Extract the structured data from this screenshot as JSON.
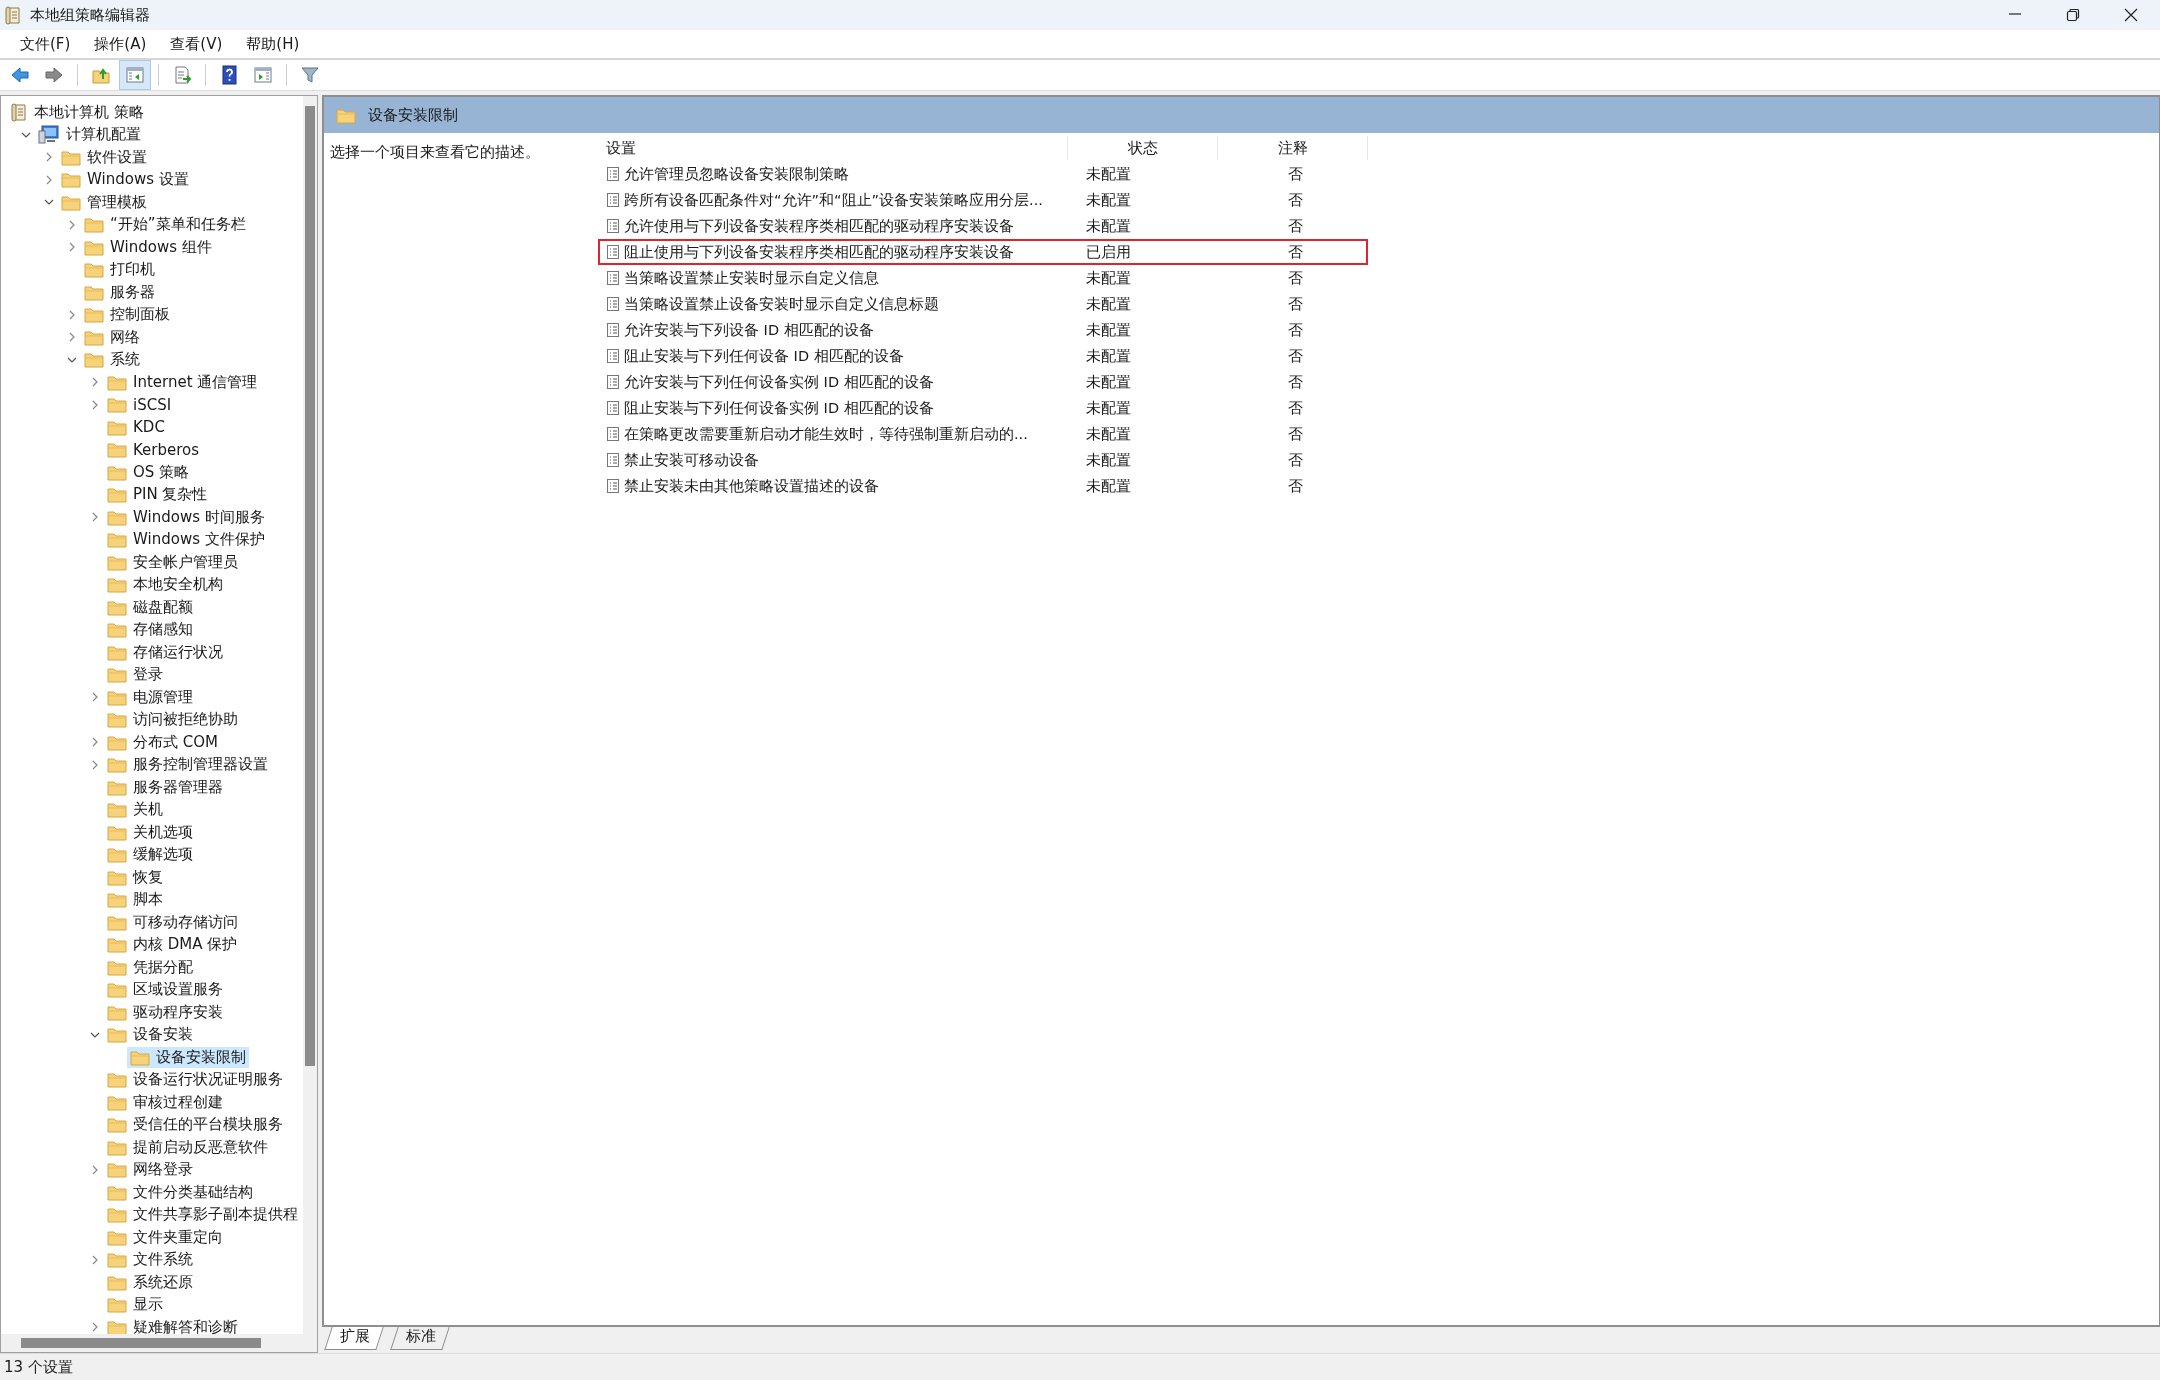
{
  "window": {
    "title": "本地组策略编辑器"
  },
  "menu": [
    "文件(F)",
    "操作(A)",
    "查看(V)",
    "帮助(H)"
  ],
  "toolbar": [
    {
      "pressed": false
    },
    {
      "pressed": false
    },
    {
      "pressed": false
    },
    {
      "pressed": true
    },
    {
      "pressed": false
    },
    {
      "pressed": false
    },
    {
      "pressed": false
    },
    {
      "pressed": false
    }
  ],
  "tree": [
    {
      "label": "本地计算机 策略",
      "kind": "policy",
      "selected": false,
      "children": [
        {
          "label": "计算机配置",
          "kind": "computer",
          "selected": false,
          "expanded": true,
          "children": [
            {
              "label": "软件设置",
              "kind": "folder",
              "selected": false,
              "expanded": false
            },
            {
              "label": "Windows 设置",
              "kind": "folder",
              "selected": false,
              "expanded": false
            },
            {
              "label": "管理模板",
              "kind": "folder",
              "selected": false,
              "expanded": true,
              "children": [
                {
                  "label": "“开始”菜单和任务栏",
                  "kind": "folder",
                  "selected": false,
                  "expanded": false
                },
                {
                  "label": "Windows 组件",
                  "kind": "folder",
                  "selected": false,
                  "expanded": false
                },
                {
                  "label": "打印机",
                  "kind": "folder",
                  "selected": false
                },
                {
                  "label": "服务器",
                  "kind": "folder",
                  "selected": false
                },
                {
                  "label": "控制面板",
                  "kind": "folder",
                  "selected": false,
                  "expanded": false
                },
                {
                  "label": "网络",
                  "kind": "folder",
                  "selected": false,
                  "expanded": false
                },
                {
                  "label": "系统",
                  "kind": "folder",
                  "selected": false,
                  "expanded": true,
                  "children": [
                    {
                      "label": "Internet 通信管理",
                      "kind": "folder",
                      "selected": false,
                      "expanded": false
                    },
                    {
                      "label": "iSCSI",
                      "kind": "folder",
                      "selected": false,
                      "expanded": false
                    },
                    {
                      "label": "KDC",
                      "kind": "folder",
                      "selected": false
                    },
                    {
                      "label": "Kerberos",
                      "kind": "folder",
                      "selected": false
                    },
                    {
                      "label": "OS 策略",
                      "kind": "folder",
                      "selected": false
                    },
                    {
                      "label": "PIN 复杂性",
                      "kind": "folder",
                      "selected": false
                    },
                    {
                      "label": "Windows 时间服务",
                      "kind": "folder",
                      "selected": false,
                      "expanded": false
                    },
                    {
                      "label": "Windows 文件保护",
                      "kind": "folder",
                      "selected": false
                    },
                    {
                      "label": "安全帐户管理员",
                      "kind": "folder",
                      "selected": false
                    },
                    {
                      "label": "本地安全机构",
                      "kind": "folder",
                      "selected": false
                    },
                    {
                      "label": "磁盘配额",
                      "kind": "folder",
                      "selected": false
                    },
                    {
                      "label": "存储感知",
                      "kind": "folder",
                      "selected": false
                    },
                    {
                      "label": "存储运行状况",
                      "kind": "folder",
                      "selected": false
                    },
                    {
                      "label": "登录",
                      "kind": "folder",
                      "selected": false
                    },
                    {
                      "label": "电源管理",
                      "kind": "folder",
                      "selected": false,
                      "expanded": false
                    },
                    {
                      "label": "访问被拒绝协助",
                      "kind": "folder",
                      "selected": false
                    },
                    {
                      "label": "分布式 COM",
                      "kind": "folder",
                      "selected": false,
                      "expanded": false
                    },
                    {
                      "label": "服务控制管理器设置",
                      "kind": "folder",
                      "selected": false,
                      "expanded": false
                    },
                    {
                      "label": "服务器管理器",
                      "kind": "folder",
                      "selected": false
                    },
                    {
                      "label": "关机",
                      "kind": "folder",
                      "selected": false
                    },
                    {
                      "label": "关机选项",
                      "kind": "folder",
                      "selected": false
                    },
                    {
                      "label": "缓解选项",
                      "kind": "folder",
                      "selected": false
                    },
                    {
                      "label": "恢复",
                      "kind": "folder",
                      "selected": false
                    },
                    {
                      "label": "脚本",
                      "kind": "folder",
                      "selected": false
                    },
                    {
                      "label": "可移动存储访问",
                      "kind": "folder",
                      "selected": false
                    },
                    {
                      "label": "内核 DMA 保护",
                      "kind": "folder",
                      "selected": false
                    },
                    {
                      "label": "凭据分配",
                      "kind": "folder",
                      "selected": false
                    },
                    {
                      "label": "区域设置服务",
                      "kind": "folder",
                      "selected": false
                    },
                    {
                      "label": "驱动程序安装",
                      "kind": "folder",
                      "selected": false
                    },
                    {
                      "label": "设备安装",
                      "kind": "folder",
                      "selected": false,
                      "expanded": true,
                      "children": [
                        {
                          "label": "设备安装限制",
                          "kind": "folder",
                          "selected": true
                        }
                      ]
                    },
                    {
                      "label": "设备运行状况证明服务",
                      "kind": "folder",
                      "selected": false
                    },
                    {
                      "label": "审核过程创建",
                      "kind": "folder",
                      "selected": false
                    },
                    {
                      "label": "受信任的平台模块服务",
                      "kind": "folder",
                      "selected": false
                    },
                    {
                      "label": "提前启动反恶意软件",
                      "kind": "folder",
                      "selected": false
                    },
                    {
                      "label": "网络登录",
                      "kind": "folder",
                      "selected": false,
                      "expanded": false
                    },
                    {
                      "label": "文件分类基础结构",
                      "kind": "folder",
                      "selected": false
                    },
                    {
                      "label": "文件共享影子副本提供程",
                      "kind": "folder",
                      "selected": false
                    },
                    {
                      "label": "文件夹重定向",
                      "kind": "folder",
                      "selected": false
                    },
                    {
                      "label": "文件系统",
                      "kind": "folder",
                      "selected": false,
                      "expanded": false
                    },
                    {
                      "label": "系统还原",
                      "kind": "folder",
                      "selected": false
                    },
                    {
                      "label": "显示",
                      "kind": "folder",
                      "selected": false
                    },
                    {
                      "label": "疑难解答和诊断",
                      "kind": "folder",
                      "selected": false,
                      "expanded": false
                    }
                  ]
                }
              ]
            }
          ]
        }
      ]
    }
  ],
  "details": {
    "title": "设备安装限制",
    "description": "选择一个项目来查看它的描述。",
    "columns": [
      "设置",
      "状态",
      "注释"
    ],
    "rows": [
      {
        "setting": "允许管理员忽略设备安装限制策略",
        "status": "未配置",
        "comment": "否",
        "outlined": false
      },
      {
        "setting": "跨所有设备匹配条件对“允许”和“阻止”设备安装策略应用分层...",
        "status": "未配置",
        "comment": "否",
        "outlined": false
      },
      {
        "setting": "允许使用与下列设备安装程序类相匹配的驱动程序安装设备",
        "status": "未配置",
        "comment": "否",
        "outlined": false
      },
      {
        "setting": "阻止使用与下列设备安装程序类相匹配的驱动程序安装设备",
        "status": "已启用",
        "comment": "否",
        "outlined": true
      },
      {
        "setting": "当策略设置禁止安装时显示自定义信息",
        "status": "未配置",
        "comment": "否",
        "outlined": false
      },
      {
        "setting": "当策略设置禁止设备安装时显示自定义信息标题",
        "status": "未配置",
        "comment": "否",
        "outlined": false
      },
      {
        "setting": "允许安装与下列设备 ID 相匹配的设备",
        "status": "未配置",
        "comment": "否",
        "outlined": false
      },
      {
        "setting": "阻止安装与下列任何设备 ID 相匹配的设备",
        "status": "未配置",
        "comment": "否",
        "outlined": false
      },
      {
        "setting": "允许安装与下列任何设备实例 ID 相匹配的设备",
        "status": "未配置",
        "comment": "否",
        "outlined": false
      },
      {
        "setting": "阻止安装与下列任何设备实例 ID 相匹配的设备",
        "status": "未配置",
        "comment": "否",
        "outlined": false
      },
      {
        "setting": "在策略更改需要重新启动才能生效时，等待强制重新启动的...",
        "status": "未配置",
        "comment": "否",
        "outlined": false
      },
      {
        "setting": "禁止安装可移动设备",
        "status": "未配置",
        "comment": "否",
        "outlined": false
      },
      {
        "setting": "禁止安装未由其他策略设置描述的设备",
        "status": "未配置",
        "comment": "否",
        "outlined": false
      }
    ]
  },
  "view_tabs": [
    {
      "label": "扩展",
      "selected": true
    },
    {
      "label": "标准",
      "selected": false
    }
  ],
  "status_bar": "13 个设置"
}
